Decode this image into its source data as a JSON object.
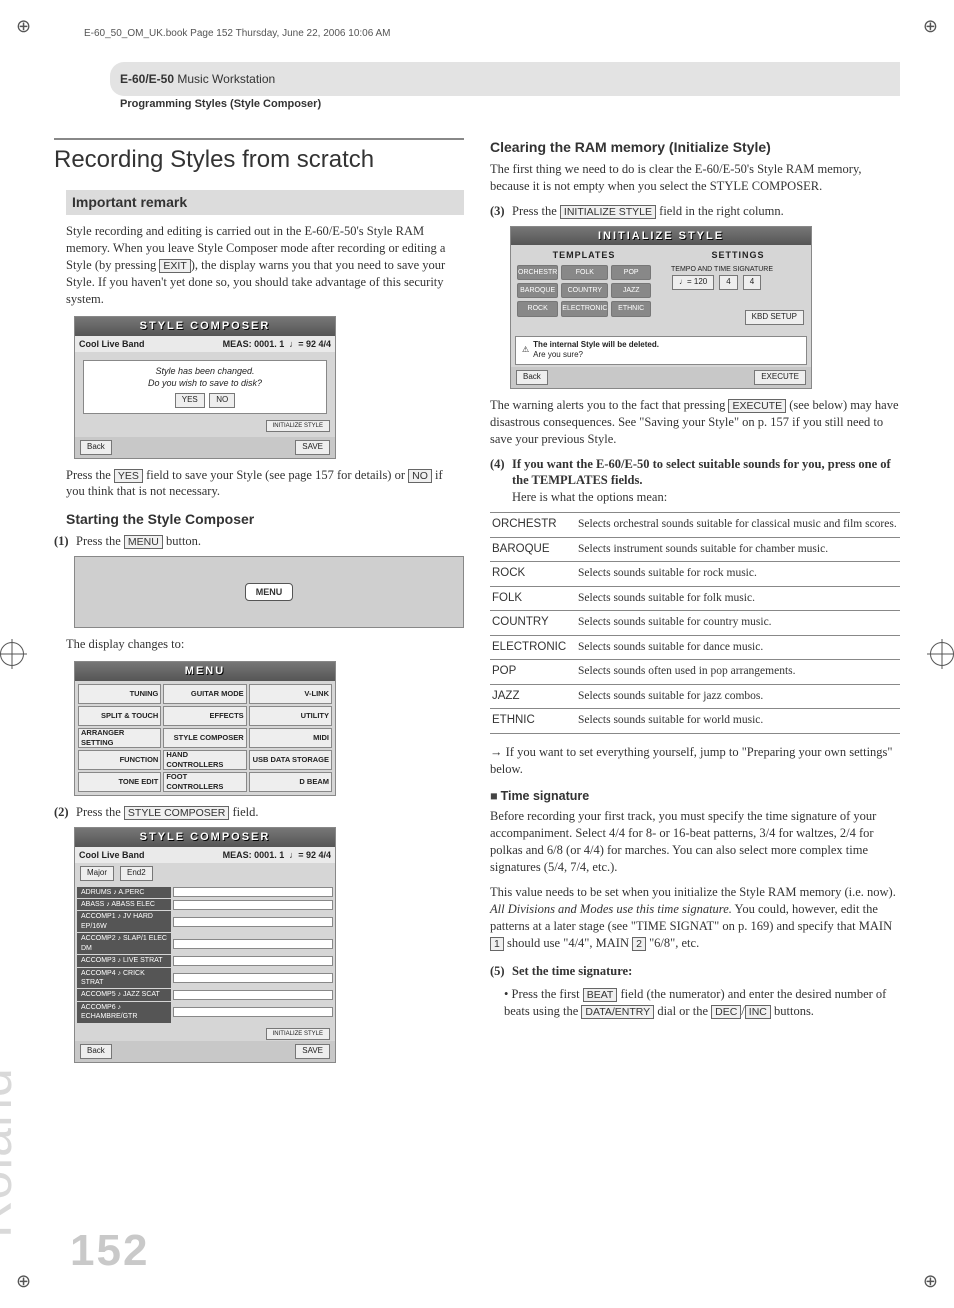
{
  "meta": {
    "header_line": "E-60_50_OM_UK.book  Page 152  Thursday, June 22, 2006  10:06 AM",
    "brand": "Roland",
    "page_number": "152",
    "product_line": "E-60/E-50",
    "product_suffix": " Music Workstation",
    "section_sub": "Programming Styles (Style Composer)"
  },
  "left": {
    "h1": "Recording Styles from scratch",
    "remark_title": "Important remark",
    "remark_body_a": "Style recording and editing is carried out in the E-60/E-50's Style RAM memory. When you leave Style Composer mode after recording or editing a Style (by pressing ",
    "remark_exit": "EXIT",
    "remark_body_b": "), the display warns you that you need to save your Style. If you haven't yet done so, you should take advantage of this security system.",
    "shot1": {
      "title": "STYLE COMPOSER",
      "song": "Cool Live Band",
      "meas": "MEAS: 0001. 1",
      "tempo": "♩= 92  4/4",
      "dialog1": "Style has been changed.",
      "dialog2": "Do you wish to save to disk?",
      "yes": "YES",
      "no": "NO",
      "init": "INITIALIZE STYLE",
      "back": "Back",
      "save": "SAVE"
    },
    "after_shot1_a": "Press the ",
    "yes_btn": "YES",
    "after_shot1_b": " field to save your Style (see page 157 for details) or ",
    "no_btn": "NO",
    "after_shot1_c": " if you think that is not necessary.",
    "h2_start": "Starting the Style Composer",
    "step1_a": "Press the ",
    "menu_btn": "MENU",
    "step1_b": " button.",
    "menu_bubble": "MENU",
    "display_changes": "The display changes to:",
    "menu_shot": {
      "title": "MENU",
      "cells": [
        "TUNING",
        "GUITAR MODE",
        "V-LINK",
        "SPLIT & TOUCH",
        "EFFECTS",
        "UTILITY",
        "ARRANGER SETTING",
        "STYLE COMPOSER",
        "MIDI",
        "FUNCTION",
        "HAND CONTROLLERS",
        "USB DATA STORAGE",
        "TONE EDIT",
        "FOOT CONTROLLERS",
        "D BEAM"
      ]
    },
    "step2_a": "Press the ",
    "sc_btn": "STYLE COMPOSER",
    "step2_b": " field.",
    "shot3": {
      "title": "STYLE COMPOSER",
      "song": "Cool Live Band",
      "meas": "MEAS: 0001. 1",
      "tempo": "♩= 92  4/4",
      "mode": "Major",
      "division": "End2",
      "tracks": [
        "ADRUMS  ♪ A.PERC",
        "ABASS  ♪ ABASS ELEC",
        "ACCOMP1 ♪ JV HARD EP/16W",
        "ACCOMP2 ♪ SLAP/1 ELEC DM",
        "ACCOMP3 ♪ LIVE STRAT",
        "ACCOMP4 ♪ CRICK STRAT",
        "ACCOMP5 ♪ JAZZ SCAT",
        "ACCOMP6 ♪ ECHAMBRE/GTR"
      ],
      "init": "INITIALIZE STYLE",
      "back": "Back",
      "save": "SAVE"
    }
  },
  "right": {
    "h2_clear": "Clearing the RAM memory (Initialize Style)",
    "clear_body": "The first thing we need to do is clear the E-60/E-50's Style RAM memory, because it is not empty when you select the STYLE COMPOSER.",
    "step3_a": "Press the ",
    "init_btn": "INITIALIZE STYLE",
    "step3_b": " field in the right column.",
    "ishot": {
      "title": "INITIALIZE STYLE",
      "templates_h": "TEMPLATES",
      "settings_h": "SETTINGS",
      "tempo_label": "TEMPO AND TIME SIGNATURE",
      "tempo": "♩= 120",
      "beat1": "4",
      "beat2": "4",
      "kbd": "KBD SETUP",
      "tmpl": [
        "ORCHESTR",
        "FOLK",
        "POP",
        "BAROQUE",
        "COUNTRY",
        "JAZZ",
        "ROCK",
        "ELECTRONIC",
        "ETHNIC"
      ],
      "warn1": "The internal Style will be deleted.",
      "warn2": "Are you sure?",
      "back": "Back",
      "execute": "EXECUTE"
    },
    "after_ishot_a": "The warning alerts you to the fact that pressing ",
    "exec_btn": "EXECUTE",
    "after_ishot_b": " (see below) may have disastrous consequences. See \"Saving your Style\" on p. 157 if you still need to save your previous Style.",
    "step4_strong": "If you want the E-60/E-50 to select suitable sounds for you, press one of the TEMPLATES fields.",
    "step4_tail": "Here is what the options mean:",
    "table": [
      {
        "k": "ORCHESTR",
        "v": "Selects orchestral sounds suitable for classical music and film scores."
      },
      {
        "k": "BAROQUE",
        "v": "Selects instrument sounds suitable for chamber music."
      },
      {
        "k": "ROCK",
        "v": "Selects sounds suitable for rock music."
      },
      {
        "k": "FOLK",
        "v": "Selects sounds suitable for folk music."
      },
      {
        "k": "COUNTRY",
        "v": "Selects sounds suitable for country music."
      },
      {
        "k": "ELECTRONIC",
        "v": "Selects sounds suitable for dance music."
      },
      {
        "k": "POP",
        "v": "Selects sounds often used in pop arrangements."
      },
      {
        "k": "JAZZ",
        "v": "Selects sounds suitable for jazz combos."
      },
      {
        "k": "ETHNIC",
        "v": "Selects sounds suitable for world music."
      }
    ],
    "jump_note": "→ If you want to set everything yourself, jump to \"Preparing your own settings\" below.",
    "tsig_h": "Time signature",
    "tsig_p1": "Before recording your first track, you must specify the time signature of your accompaniment. Select 4/4 for 8- or 16-beat patterns, 3/4 for waltzes, 2/4 for polkas and 6/8 (or 4/4) for marches. You can also select more complex time signatures (5/4, 7/4, etc.).",
    "tsig_p2_a": "This value needs to be set when you initialize the Style RAM memory (i.e. now). ",
    "tsig_p2_em": "All Divisions and Modes use this time signature.",
    "tsig_p2_b": " You could, however, edit the patterns at a later stage (see \"TIME SIGNAT\" on p. 169) and specify that MAIN ",
    "one_btn": "1",
    "tsig_p2_c": " should use \"4/4\", MAIN ",
    "two_btn": "2",
    "tsig_p2_d": " \"6/8\", etc.",
    "step5": "Set the time signature:",
    "step5_bullet_a": "Press the first ",
    "beat_btn": "BEAT",
    "step5_bullet_b": " field (the numerator) and enter the desired number of beats using the ",
    "de_btn": "DATA/ENTRY",
    "step5_bullet_c": " dial or the ",
    "dec_btn": "DEC",
    "slash": "/",
    "inc_btn": "INC",
    "step5_bullet_d": " buttons."
  }
}
